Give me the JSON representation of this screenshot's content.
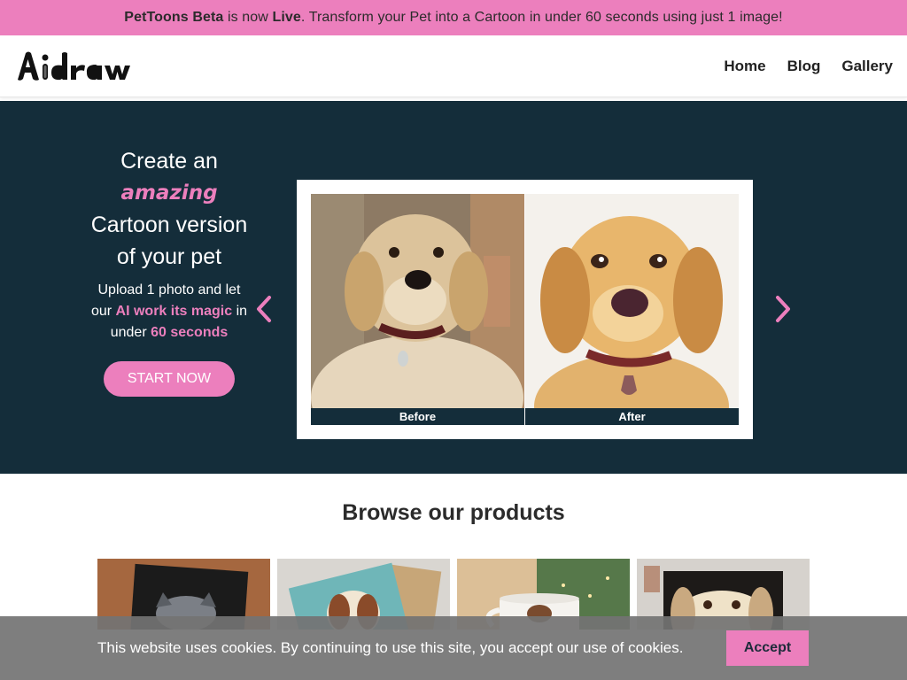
{
  "banner": {
    "brand": "PetToons Beta",
    "text_1": " is now ",
    "live": "Live",
    "text_2": ". Transform your Pet into a Cartoon in under 60 seconds using just 1 image!"
  },
  "header": {
    "logo": "Aidraw",
    "nav": [
      "Home",
      "Blog",
      "Gallery"
    ]
  },
  "hero": {
    "title_1": "Create an",
    "title_accent": "amazing",
    "title_2": "Cartoon version of your pet",
    "sub_1": "Upload 1 photo and let our ",
    "sub_accent_1": "AI work its magic",
    "sub_2": " in under ",
    "sub_accent_2": "60 seconds",
    "cta": "START NOW"
  },
  "slider": {
    "before_label": "Before",
    "after_label": "After",
    "prev_icon": "chevron-left-icon",
    "next_icon": "chevron-right-icon"
  },
  "products": {
    "title": "Browse our products"
  },
  "cookie": {
    "text": "This website uses cookies. By continuing to use this site, you accept our use of cookies.",
    "accept": "Accept"
  },
  "colors": {
    "pink": "#ec7fbd",
    "navy": "#142d3a"
  }
}
